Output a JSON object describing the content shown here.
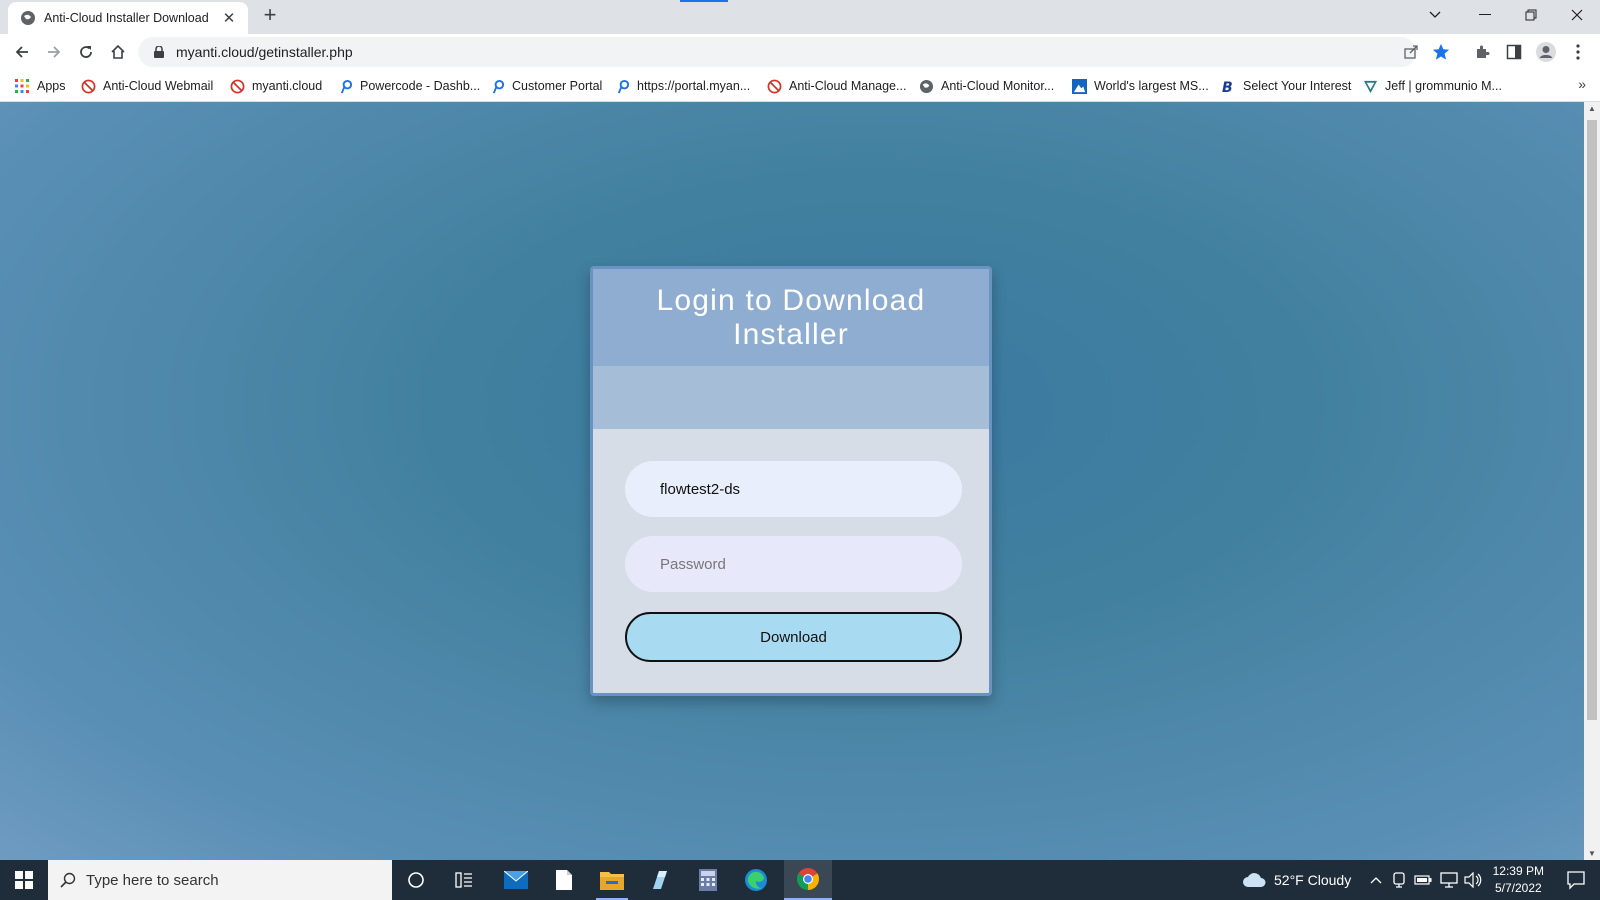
{
  "browser": {
    "tab_title": "Anti-Cloud Installer Download",
    "tab_close": "✕",
    "new_tab": "+",
    "url": "myanti.cloud/getinstaller.php"
  },
  "bookmarks": {
    "items": [
      {
        "label": "Apps",
        "icon": "apps-grid-icon"
      },
      {
        "label": "Anti-Cloud Webmail",
        "icon": "anticloud-icon"
      },
      {
        "label": "myanti.cloud",
        "icon": "anticloud-icon"
      },
      {
        "label": "Powercode - Dashb...",
        "icon": "powercode-icon"
      },
      {
        "label": "Customer Portal",
        "icon": "powercode-icon"
      },
      {
        "label": "https://portal.myan...",
        "icon": "powercode-icon"
      },
      {
        "label": "Anti-Cloud Manage...",
        "icon": "anticloud-icon"
      },
      {
        "label": "Anti-Cloud Monitor...",
        "icon": "globe-icon"
      },
      {
        "label": "World's largest MS...",
        "icon": "image-icon"
      },
      {
        "label": "Select Your Interest",
        "icon": "b-logo-icon"
      },
      {
        "label": "Jeff | grommunio M...",
        "icon": "grommunio-icon"
      }
    ],
    "more": "»"
  },
  "login": {
    "title": "Login to Download Installer",
    "username_value": "flowtest2-ds",
    "password_placeholder": "Password",
    "button_label": "Download"
  },
  "taskbar": {
    "search_placeholder": "Type here to search",
    "weather": "52°F  Cloudy",
    "time": "12:39 PM",
    "date": "5/7/2022"
  },
  "colors": {
    "page_background": "#3f7ea3",
    "card_header": "#8eadd0",
    "card_band": "#a6bdd8",
    "card_body": "#d6dde6",
    "download_button": "#a8dbf2"
  }
}
